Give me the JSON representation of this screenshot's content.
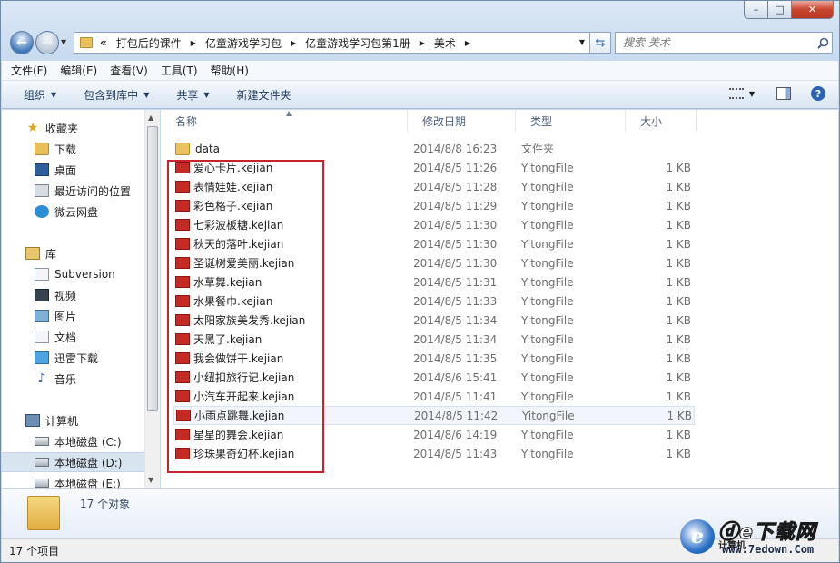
{
  "window": {
    "caption": {
      "minimize": "–",
      "maximize": "□",
      "close": "✕"
    }
  },
  "address": {
    "overflow": "«",
    "crumbs": [
      "打包后的课件",
      "亿童游戏学习包",
      "亿童游戏学习包第1册",
      "美术"
    ]
  },
  "search": {
    "placeholder": "搜索 美术"
  },
  "menubar": [
    "文件(F)",
    "编辑(E)",
    "查看(V)",
    "工具(T)",
    "帮助(H)"
  ],
  "commands": [
    "组织",
    "包含到库中",
    "共享",
    "新建文件夹"
  ],
  "navpane": {
    "favorites": {
      "header": "收藏夹",
      "items": [
        "下载",
        "桌面",
        "最近访问的位置",
        "微云网盘"
      ]
    },
    "libraries": {
      "header": "库",
      "items": [
        "Subversion",
        "视频",
        "图片",
        "文档",
        "迅雷下载",
        "音乐"
      ]
    },
    "computer": {
      "header": "计算机",
      "items": [
        "本地磁盘 (C:)",
        "本地磁盘 (D:)",
        "本地磁盘 (E:)"
      ]
    }
  },
  "columns": {
    "name": "名称",
    "date": "修改日期",
    "type": "类型",
    "size": "大小"
  },
  "files": [
    {
      "name": "data",
      "date": "2014/8/8 16:23",
      "type": "文件夹",
      "size": "",
      "icon": "folder-icon"
    },
    {
      "name": "爱心卡片.kejian",
      "date": "2014/8/5 11:26",
      "type": "YitongFile",
      "size": "1 KB",
      "icon": "kejian-file-icon"
    },
    {
      "name": "表情娃娃.kejian",
      "date": "2014/8/5 11:28",
      "type": "YitongFile",
      "size": "1 KB",
      "icon": "kejian-file-icon"
    },
    {
      "name": "彩色格子.kejian",
      "date": "2014/8/5 11:29",
      "type": "YitongFile",
      "size": "1 KB",
      "icon": "kejian-file-icon"
    },
    {
      "name": "七彩波板糖.kejian",
      "date": "2014/8/5 11:30",
      "type": "YitongFile",
      "size": "1 KB",
      "icon": "kejian-file-icon"
    },
    {
      "name": "秋天的落叶.kejian",
      "date": "2014/8/5 11:30",
      "type": "YitongFile",
      "size": "1 KB",
      "icon": "kejian-file-icon"
    },
    {
      "name": "圣诞树爱美丽.kejian",
      "date": "2014/8/5 11:30",
      "type": "YitongFile",
      "size": "1 KB",
      "icon": "kejian-file-icon"
    },
    {
      "name": "水草舞.kejian",
      "date": "2014/8/5 11:31",
      "type": "YitongFile",
      "size": "1 KB",
      "icon": "kejian-file-icon"
    },
    {
      "name": "水果餐巾.kejian",
      "date": "2014/8/5 11:33",
      "type": "YitongFile",
      "size": "1 KB",
      "icon": "kejian-file-icon"
    },
    {
      "name": "太阳家族美发秀.kejian",
      "date": "2014/8/5 11:34",
      "type": "YitongFile",
      "size": "1 KB",
      "icon": "kejian-file-icon"
    },
    {
      "name": "天黑了.kejian",
      "date": "2014/8/5 11:34",
      "type": "YitongFile",
      "size": "1 KB",
      "icon": "kejian-file-icon"
    },
    {
      "name": "我会做饼干.kejian",
      "date": "2014/8/5 11:35",
      "type": "YitongFile",
      "size": "1 KB",
      "icon": "kejian-file-icon"
    },
    {
      "name": "小纽扣旅行记.kejian",
      "date": "2014/8/6 15:41",
      "type": "YitongFile",
      "size": "1 KB",
      "icon": "kejian-file-icon"
    },
    {
      "name": "小汽车开起来.kejian",
      "date": "2014/8/5 11:41",
      "type": "YitongFile",
      "size": "1 KB",
      "icon": "kejian-file-icon"
    },
    {
      "name": "小雨点跳舞.kejian",
      "date": "2014/8/5 11:42",
      "type": "YitongFile",
      "size": "1 KB",
      "icon": "kejian-file-icon"
    },
    {
      "name": "星星的舞会.kejian",
      "date": "2014/8/6 14:19",
      "type": "YitongFile",
      "size": "1 KB",
      "icon": "kejian-file-icon"
    },
    {
      "name": "珍珠果奇幻杯.kejian",
      "date": "2014/8/5 11:43",
      "type": "YitongFile",
      "size": "1 KB",
      "icon": "kejian-file-icon"
    }
  ],
  "details": {
    "count": "17 个对象"
  },
  "status": {
    "text": "17 个项目"
  },
  "watermark": {
    "logo": "e",
    "title": "ⓓe下载网",
    "overlay": "计算机",
    "url": "www.7edown.Com"
  },
  "colors": {
    "highlight_box": "#c8232c",
    "accent": "#2a62b6"
  }
}
